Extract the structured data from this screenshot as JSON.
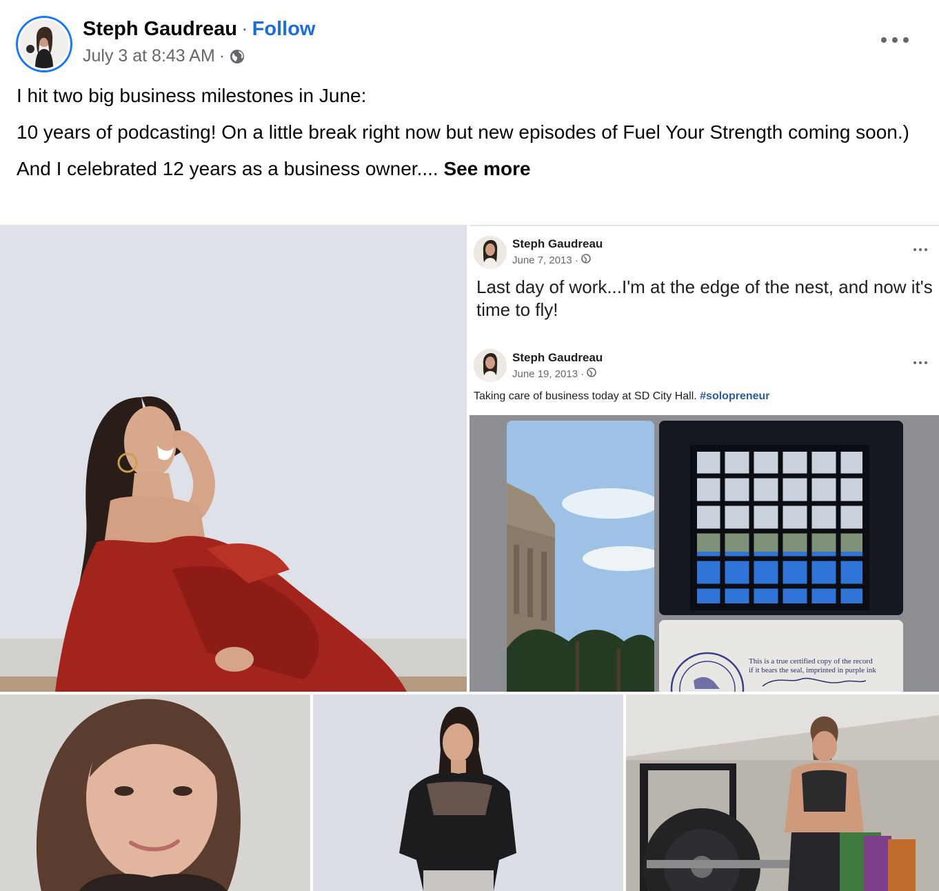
{
  "post": {
    "author": "Steph Gaudreau",
    "separator": "·",
    "follow_label": "Follow",
    "timestamp": "July 3 at 8:43 AM",
    "meta_separator": "·",
    "audience_icon": "globe-icon",
    "more_icon": "more-options-icon",
    "paragraphs": [
      "I hit two big business milestones in June:",
      "10 years of podcasting! On a little break right now but new episodes of Fuel Your Strength coming soon.)",
      "And I celebrated 12 years as a business owner.... "
    ],
    "see_more_label": "See more"
  },
  "embedded": {
    "post1": {
      "author": "Steph Gaudreau",
      "date": "June 7, 2013 ·",
      "text": "Last day of work...I'm at the edge of the nest, and now it's time to fly!"
    },
    "post2": {
      "author": "Steph Gaudreau",
      "date": "June 19, 2013 ·",
      "text": "Taking care of business today at SD City Hall. ",
      "hashtag": "#solopreneur"
    },
    "certificate": {
      "line1": "This is a true certified copy of the record",
      "line2": "if it bears the seal, imprinted in purple ink"
    }
  },
  "colors": {
    "accent": "#1877f2",
    "follow": "#1a6ed8",
    "secondary_text": "#65676b",
    "hashtag": "#2a59a8"
  }
}
